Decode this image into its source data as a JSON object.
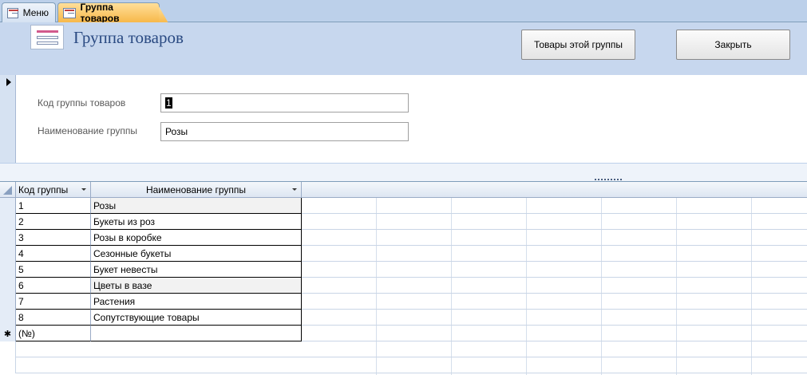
{
  "tabs": [
    {
      "label": "Меню"
    },
    {
      "label": "Группа товаров"
    }
  ],
  "header": {
    "title": "Группа товаров",
    "btn_items": "Товары этой группы",
    "btn_close": "Закрыть"
  },
  "detail": {
    "code_label": "Код группы товаров",
    "code_value": "1",
    "name_label": "Наименование группы",
    "name_value": "Розы"
  },
  "sheet": {
    "columns": [
      "Код группы",
      "Наименование группы"
    ],
    "rows": [
      {
        "code": "1",
        "name": "Розы"
      },
      {
        "code": "2",
        "name": "Букеты из роз"
      },
      {
        "code": "3",
        "name": "Розы в коробке"
      },
      {
        "code": "4",
        "name": "Сезонные букеты"
      },
      {
        "code": "5",
        "name": "Букет невесты"
      },
      {
        "code": "6",
        "name": "Цветы в вазе"
      },
      {
        "code": "7",
        "name": "Растения"
      },
      {
        "code": "8",
        "name": "Сопутствующие товары"
      }
    ],
    "new_row_marker": "✱",
    "new_row_code": "(№)"
  }
}
